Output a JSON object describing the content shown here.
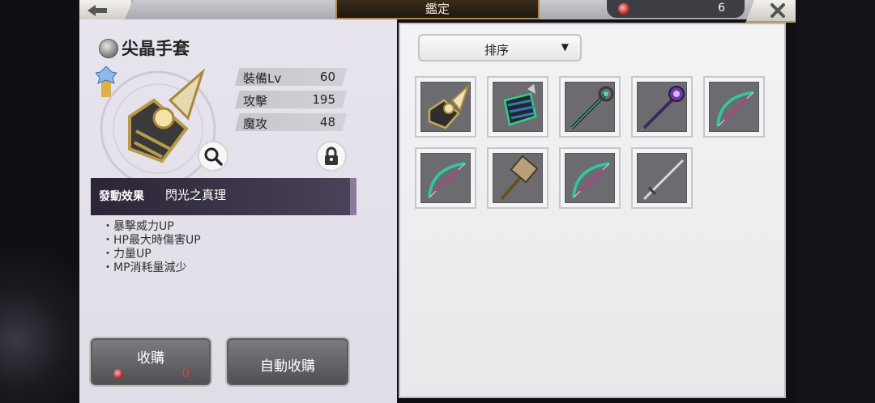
{
  "header": {
    "title": "鑑定",
    "currency_value": "6",
    "back_icon": "back-arrow-icon",
    "close_icon": "close-icon"
  },
  "item": {
    "name": "尖晶手套",
    "stats": [
      {
        "label": "裝備Lv",
        "value": "60"
      },
      {
        "label": "攻擊",
        "value": "195"
      },
      {
        "label": "魔攻",
        "value": "48"
      }
    ],
    "effect_label": "發動效果",
    "effect_name": "閃光之真理",
    "effects": [
      "・暴擊威力UP",
      "・HP最大時傷害UP",
      "・力量UP",
      "・MP消耗量減少"
    ]
  },
  "buttons": {
    "buy_label": "收購",
    "buy_cost": "0",
    "auto_buy_label": "自動收購"
  },
  "sort": {
    "label": "排序"
  },
  "inventory": [
    {
      "icon": "gauntlet-icon"
    },
    {
      "icon": "gauntlet-icon"
    },
    {
      "icon": "staff-icon"
    },
    {
      "icon": "staff-icon"
    },
    {
      "icon": "bow-icon"
    },
    {
      "icon": "bow-icon"
    },
    {
      "icon": "hammer-icon"
    },
    {
      "icon": "bow-icon"
    },
    {
      "icon": "sword-icon"
    }
  ],
  "colors": {
    "accent_gold": "#a88a4e",
    "currency_red": "#c02c2c",
    "cost_red": "#e23b3b"
  }
}
